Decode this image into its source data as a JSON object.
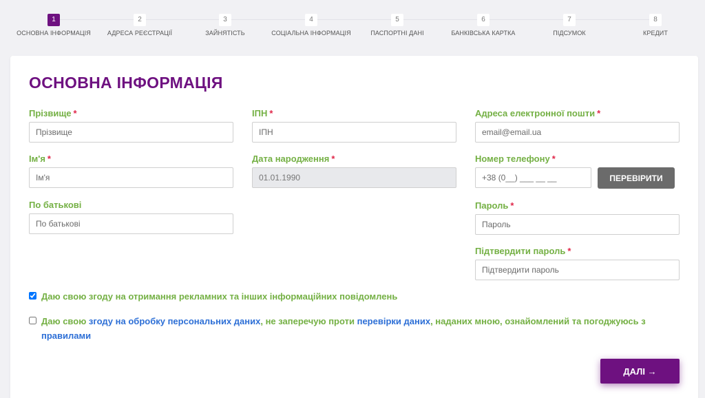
{
  "stepper": {
    "steps": [
      {
        "num": "1",
        "label": "Основна інформація"
      },
      {
        "num": "2",
        "label": "Адреса реєстрації"
      },
      {
        "num": "3",
        "label": "Зайнятість"
      },
      {
        "num": "4",
        "label": "Соціальна інформація"
      },
      {
        "num": "5",
        "label": "Паспортні дані"
      },
      {
        "num": "6",
        "label": "Банківська картка"
      },
      {
        "num": "7",
        "label": "Підсумок"
      },
      {
        "num": "8",
        "label": "Кредит"
      }
    ],
    "active_step": 1
  },
  "form": {
    "title": "ОСНОВНА ІНФОРМАЦІЯ",
    "required_mark": "*",
    "fields": {
      "surname": {
        "label": "Прізвище",
        "placeholder": "Прізвище",
        "value": ""
      },
      "first_name": {
        "label": "Ім'я",
        "placeholder": "Ім'я",
        "value": ""
      },
      "patronymic": {
        "label": "По батькові",
        "placeholder": "По батькові",
        "value": ""
      },
      "ipn": {
        "label": "ІПН",
        "placeholder": "ІПН",
        "value": ""
      },
      "birth_date": {
        "label": "Дата народження",
        "placeholder": "01.01.1990",
        "value": ""
      },
      "email": {
        "label": "Адреса електронної пошти",
        "placeholder": "email@email.ua",
        "value": ""
      },
      "phone": {
        "label": "Номер телефону",
        "placeholder": "+38 (0__) ___ __ __",
        "value": ""
      },
      "password": {
        "label": "Пароль",
        "placeholder": "Пароль",
        "value": ""
      },
      "confirm_password": {
        "label": "Підтвердити пароль",
        "placeholder": "Підтвердити пароль",
        "value": ""
      }
    },
    "verify_button": "ПЕРЕВІРИТИ",
    "consent_marketing": {
      "checked": true,
      "text": "Даю свою згоду на отримання рекламних та інших інформаційних повідомлень"
    },
    "consent_personal": {
      "checked": false,
      "part1": "Даю свою ",
      "link1": "згоду на обробку персональних даних",
      "part2": ", не заперечую проти ",
      "link2": "перевірки даних",
      "part3": ", наданих мною, ознайомлений та погоджуюсь з ",
      "link3": "правилами"
    },
    "next_button": "ДАЛІ →"
  },
  "colors": {
    "brand": "#6e1180",
    "label_green": "#74b044",
    "required_red": "#e0284a",
    "link_blue": "#2d6fd6",
    "verify_gray": "#6b6b6b"
  }
}
